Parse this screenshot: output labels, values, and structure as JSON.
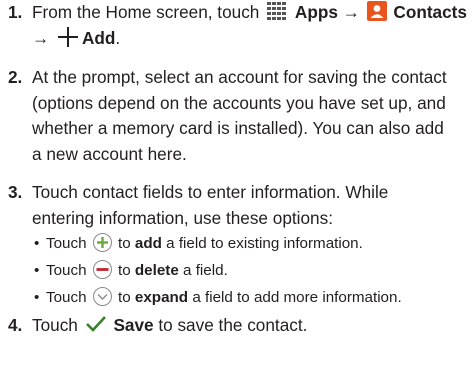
{
  "steps": [
    {
      "num": "1.",
      "line1_pre": "From the Home screen, touch",
      "apps": "Apps",
      "arrow1": "→",
      "contacts": "Contacts",
      "arrow2": "→",
      "add": "Add",
      "add_end": "."
    },
    {
      "num": "2.",
      "lines": [
        "At the prompt, select an account for saving the contact",
        "(options depend on the accounts you have set up, and",
        "whether a memory card is installed). You can also add",
        "a new account here."
      ]
    },
    {
      "num": "3.",
      "lines": [
        "Touch contact fields to enter information. While",
        "entering information, use these options:"
      ],
      "options": [
        {
          "bullet": "•",
          "touch": "Touch",
          "to": "to",
          "action": "add",
          "rest": "a field to existing information.",
          "icon": "plus-circle-icon"
        },
        {
          "bullet": "•",
          "touch": "Touch",
          "to": "to",
          "action": "delete",
          "rest": "a field.",
          "icon": "minus-circle-icon"
        },
        {
          "bullet": "•",
          "touch": "Touch",
          "to": "to",
          "action": "expand",
          "rest": "a field to add more information.",
          "icon": "chevron-down-circle-icon"
        }
      ]
    },
    {
      "num": "4.",
      "pre": "Touch",
      "save": "Save",
      "post": "to save the contact."
    }
  ],
  "colors": {
    "heading": "#1b7fbd",
    "plus_icon": "#6aa83a",
    "minus_icon": "#c0272d",
    "contacts_icon": "#e8561e",
    "check_icon": "#3b7f2c"
  }
}
